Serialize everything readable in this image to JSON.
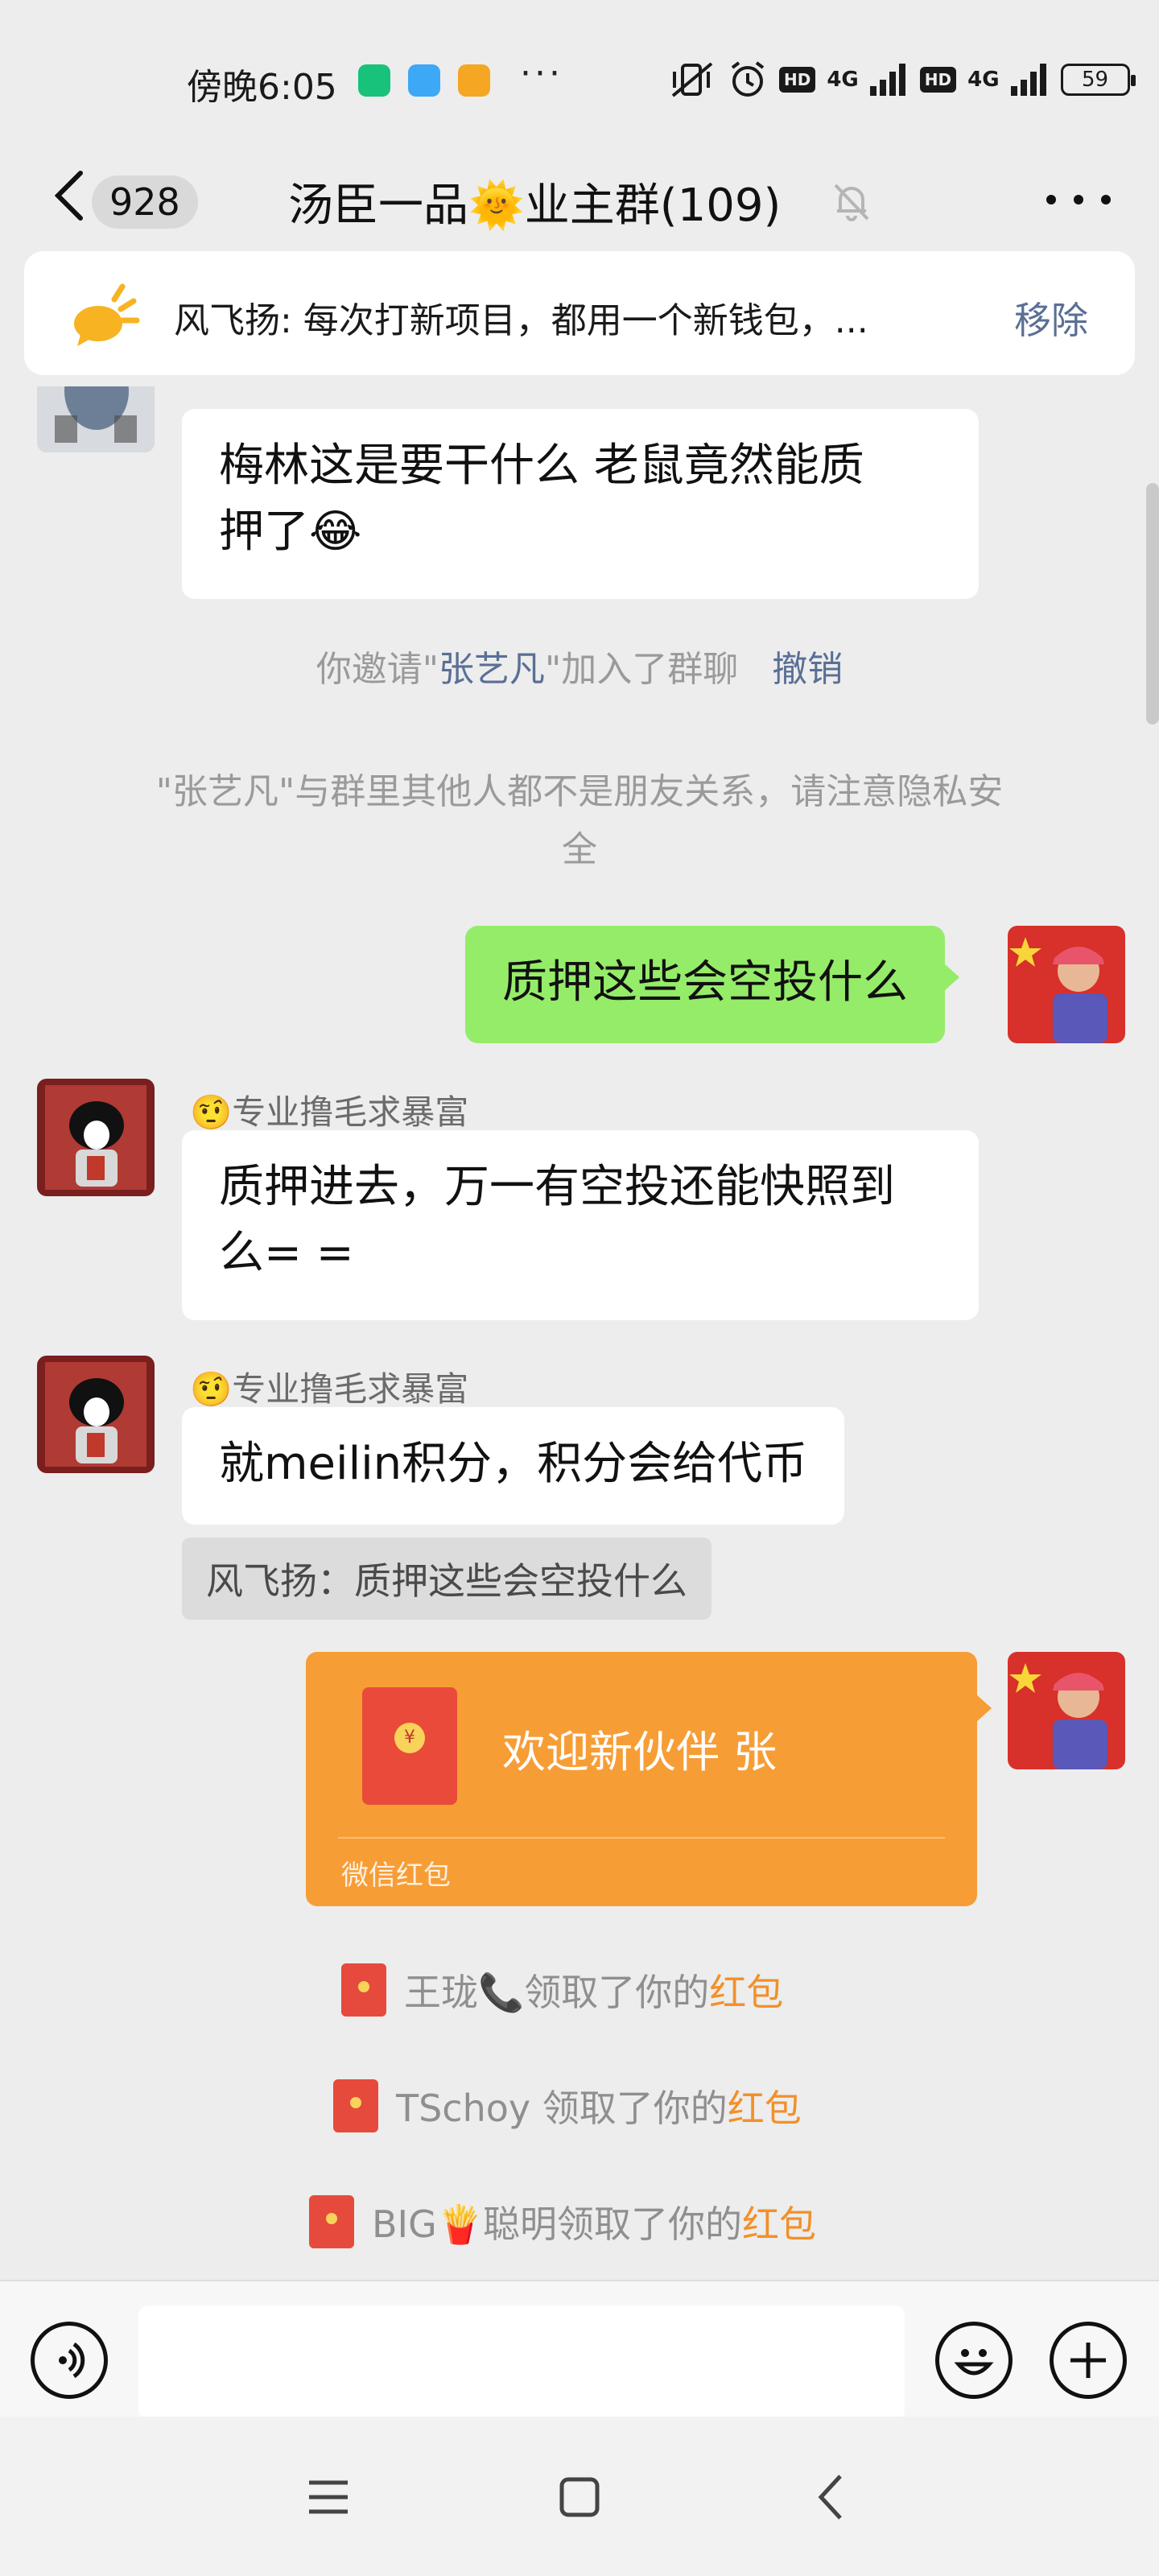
{
  "status_bar": {
    "time": "傍晚6:05",
    "more": "···",
    "network_1": "4G",
    "network_2": "4G",
    "hd": "HD",
    "battery": "59"
  },
  "header": {
    "unread_count": "928",
    "title": "汤臣一品🌞业主群(109)"
  },
  "pinned": {
    "text": "风飞扬: 每次打新项目，都用一个新钱包，...",
    "remove_label": "移除"
  },
  "messages": {
    "m1_text_line1": "梅林这是要干什么  老鼠竟然能质",
    "m1_text_line2": "押了😂",
    "sys1_prefix": "你邀请\"",
    "sys1_name": "张艺凡",
    "sys1_suffix": "\"加入了群聊",
    "sys1_action": "撤销",
    "sys2_line1": "\"张艺凡\"与群里其他人都不是朋友关系，请注意隐私安",
    "sys2_line2": "全",
    "me1_text": "质押这些会空投什么",
    "m2_sender": "🤨专业撸毛求暴富",
    "m2_text_line1": "质押进去，万一有空投还能快照到",
    "m2_text_line2": "么= =",
    "m3_sender": "🤨专业撸毛求暴富",
    "m3_text": "就meilin积分，积分会给代币",
    "m3_quote": "风飞扬：质押这些会空投什么"
  },
  "red_packet": {
    "coin": "¥",
    "title": "欢迎新伙伴  张",
    "footer": "微信红包"
  },
  "received": [
    {
      "name": "王珑📞领取了你的",
      "link": "红包"
    },
    {
      "name": "TSchoy 领取了你的",
      "link": "红包"
    },
    {
      "name": "BIG🍟聪明领取了你的",
      "link": "红包"
    }
  ],
  "colors": {
    "background": "#ededed",
    "my_bubble": "#95ec69",
    "red_packet": "#f79d36",
    "link": "#5a6f95",
    "red_packet_link": "#f2902a"
  },
  "icons": {
    "voice": "voice-icon",
    "emoji": "emoji-icon",
    "plus": "plus-icon",
    "mute": "mute-bell-icon",
    "back": "back-chevron-icon"
  }
}
